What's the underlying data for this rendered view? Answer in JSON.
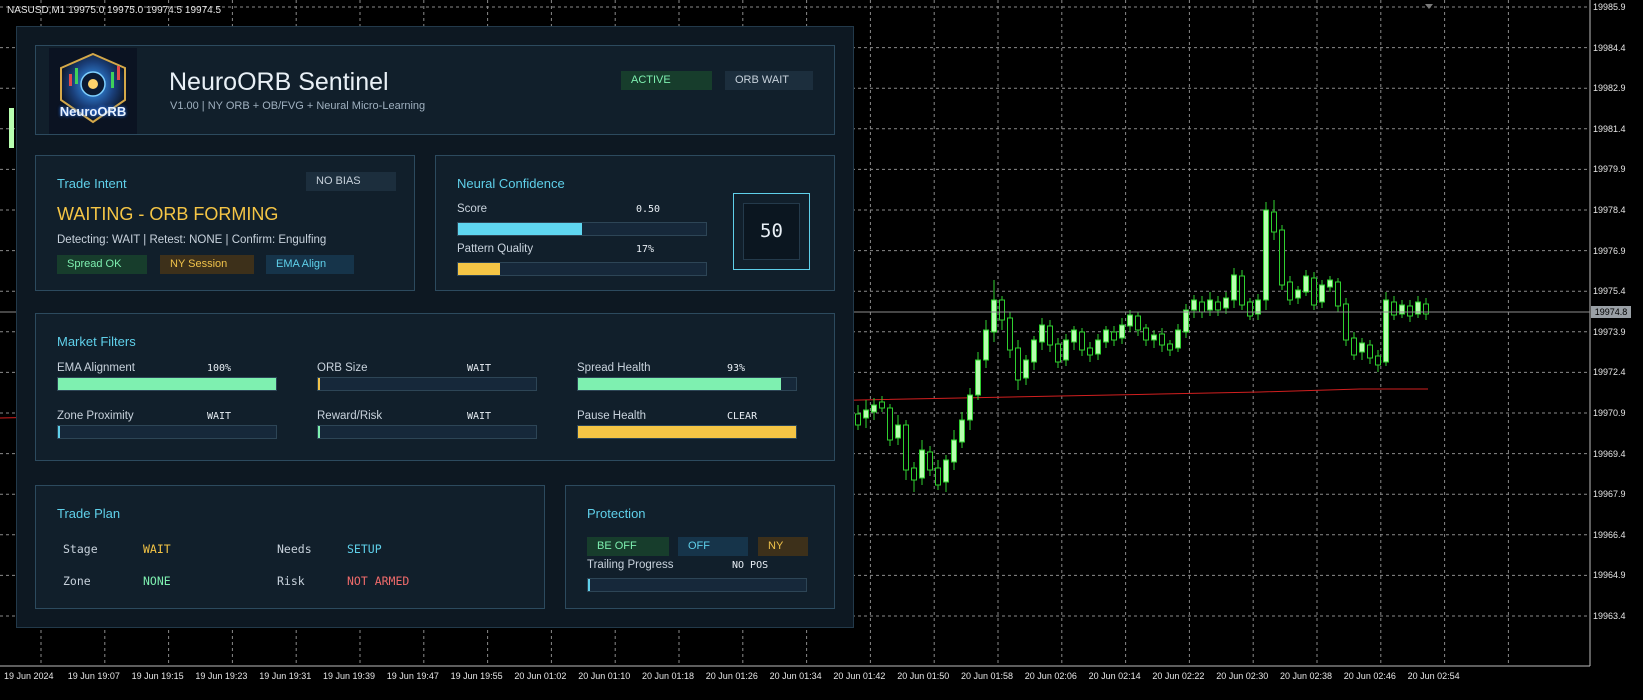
{
  "chart": {
    "symbol_line": "NASUSD,M1  19975.0 19975.0 19974.5 19974.5",
    "current_price": "19974.8",
    "price_scale": [
      "19985.9",
      "19984.4",
      "19982.9",
      "19981.4",
      "19979.9",
      "19978.4",
      "19976.9",
      "19975.4",
      "19973.9",
      "19972.4",
      "19970.9",
      "19969.4",
      "19967.9",
      "19966.4",
      "19964.9",
      "19963.4"
    ],
    "time_scale": [
      "19 Jun 2024",
      "19 Jun 19:07",
      "19 Jun 19:15",
      "19 Jun 19:23",
      "19 Jun 19:31",
      "19 Jun 19:39",
      "19 Jun 19:47",
      "19 Jun 19:55",
      "20 Jun 01:02",
      "20 Jun 01:10",
      "20 Jun 01:18",
      "20 Jun 01:26",
      "20 Jun 01:34",
      "20 Jun 01:42",
      "20 Jun 01:50",
      "20 Jun 01:58",
      "20 Jun 02:06",
      "20 Jun 02:14",
      "20 Jun 02:22",
      "20 Jun 02:30",
      "20 Jun 02:38",
      "20 Jun 02:46",
      "20 Jun 02:54"
    ],
    "colors": {
      "bull": "#b8ffb0",
      "bear": "#1f8f1f",
      "wick": "#2fd02f",
      "grid": "#8a8a8a",
      "ma": "#d11f1f"
    }
  },
  "header": {
    "title": "NeuroORB Sentinel",
    "subtitle": "V1.00 | NY ORB + OB/FVG + Neural Micro-Learning",
    "logo_text": "NeuroORB",
    "status_badge": "ACTIVE",
    "state_badge": "ORB WAIT"
  },
  "trade_intent": {
    "title": "Trade Intent",
    "bias": "NO BIAS",
    "headline": "WAITING - ORB FORMING",
    "detail": "Detecting: WAIT | Retest: NONE | Confirm: Engulfing",
    "chips": [
      "Spread OK",
      "NY Session",
      "EMA Align"
    ]
  },
  "neural": {
    "title": "Neural Confidence",
    "score_label": "Score",
    "score_value": "0.50",
    "score_fraction": 0.5,
    "pattern_label": "Pattern Quality",
    "pattern_value": "17%",
    "pattern_fraction": 0.17,
    "big_number": "50"
  },
  "filters": {
    "title": "Market Filters",
    "items": [
      {
        "label": "EMA Alignment",
        "value": "100%",
        "fraction": 1.0,
        "color": "#7ef0b0"
      },
      {
        "label": "ORB Size",
        "value": "WAIT",
        "fraction": 0.0,
        "color": "#f0c24a"
      },
      {
        "label": "Spread Health",
        "value": "93%",
        "fraction": 0.93,
        "color": "#7ef0b0"
      },
      {
        "label": "Zone Proximity",
        "value": "WAIT",
        "fraction": 0.0,
        "color": "#5fd0ea"
      },
      {
        "label": "Reward/Risk",
        "value": "WAIT",
        "fraction": 0.0,
        "color": "#7ef0b0"
      },
      {
        "label": "Pause Health",
        "value": "CLEAR",
        "fraction": 1.0,
        "color": "#f5c545"
      }
    ]
  },
  "plan": {
    "title": "Trade Plan",
    "stage_label": "Stage",
    "stage_value": "WAIT",
    "needs_label": "Needs",
    "needs_value": "SETUP",
    "zone_label": "Zone",
    "zone_value": "NONE",
    "risk_label": "Risk",
    "risk_value": "NOT ARMED"
  },
  "protection": {
    "title": "Protection",
    "chips": [
      "BE OFF",
      "OFF",
      "NY"
    ],
    "trailing_label": "Trailing Progress",
    "trailing_value": "NO POS",
    "trailing_fraction": 0.0
  }
}
